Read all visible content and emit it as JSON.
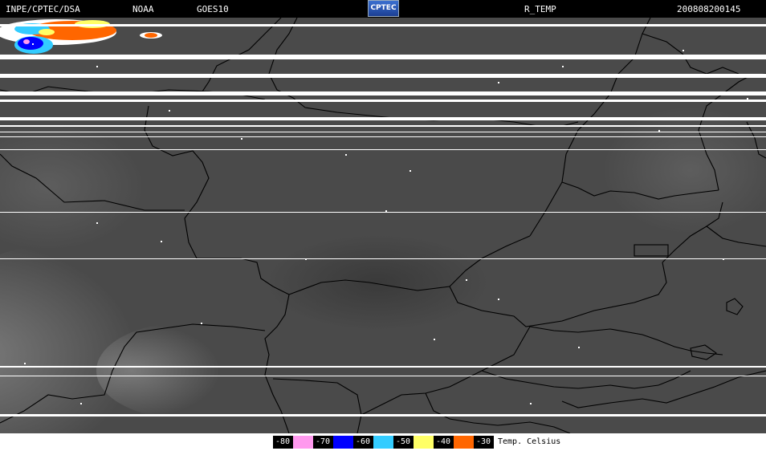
{
  "header": {
    "source": "INPE/CPTEC/DSA",
    "agency": "NOAA",
    "satellite": "GOES10",
    "logo_text": "CPTEC",
    "product": "R_TEMP",
    "timestamp": "200808200145"
  },
  "legend": {
    "unit_label": "Temp. Celsius",
    "items": [
      {
        "label": "-80",
        "color": "#000000",
        "text_color": "#ffffff"
      },
      {
        "label": "",
        "color": "#ff99ee",
        "text_color": "#000000"
      },
      {
        "label": "-70",
        "color": "#000000",
        "text_color": "#ffffff"
      },
      {
        "label": "",
        "color": "#0000ff",
        "text_color": "#ffffff"
      },
      {
        "label": "-60",
        "color": "#000000",
        "text_color": "#ffffff"
      },
      {
        "label": "",
        "color": "#33ccff",
        "text_color": "#000000"
      },
      {
        "label": "-50",
        "color": "#000000",
        "text_color": "#ffffff"
      },
      {
        "label": "",
        "color": "#ffff66",
        "text_color": "#000000"
      },
      {
        "label": "-40",
        "color": "#000000",
        "text_color": "#ffffff"
      },
      {
        "label": "",
        "color": "#ff6600",
        "text_color": "#000000"
      },
      {
        "label": "-30",
        "color": "#000000",
        "text_color": "#ffffff"
      }
    ]
  },
  "colors": {
    "background": "#4a4a4a",
    "border_line": "#000000",
    "scan_line": "#ffffff"
  }
}
